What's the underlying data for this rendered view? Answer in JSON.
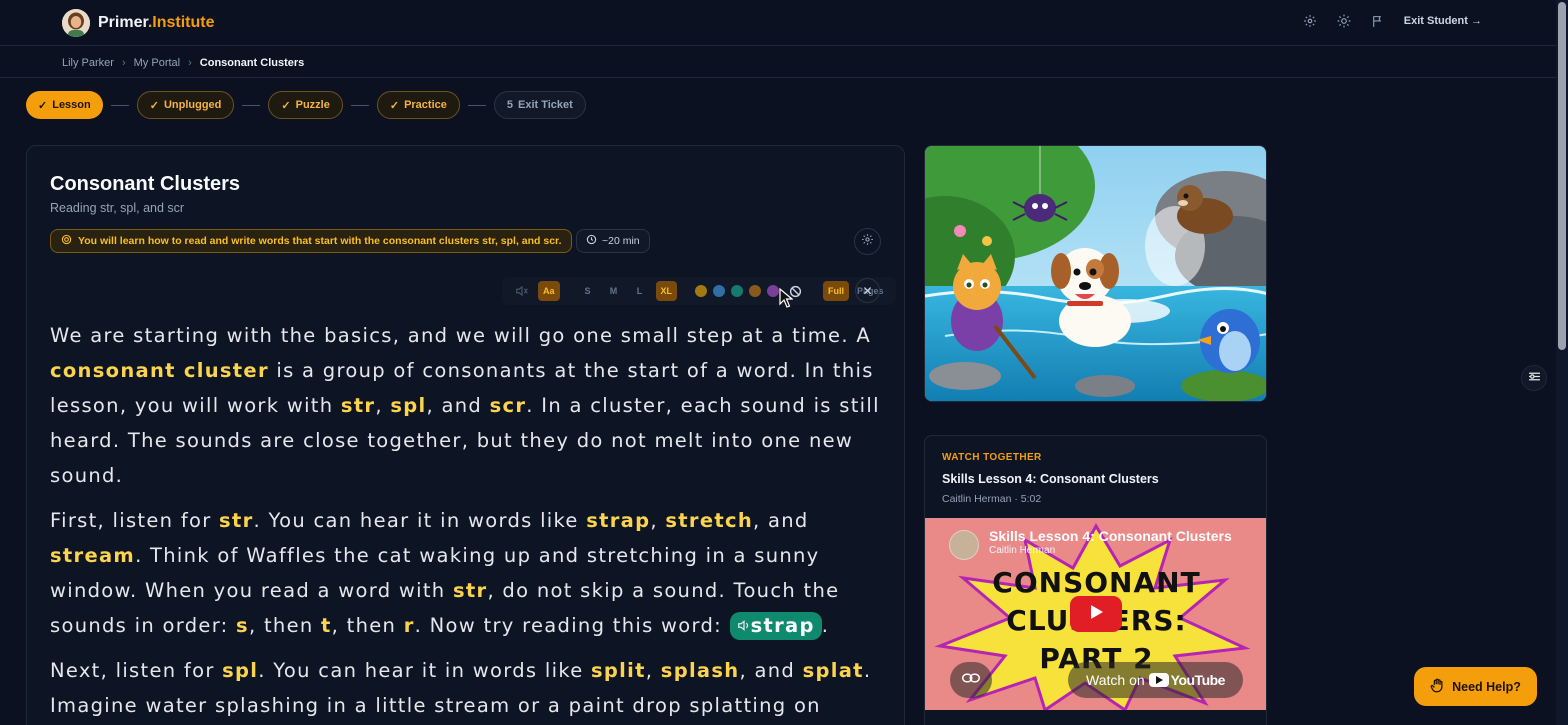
{
  "header": {
    "brand_primary": "Primer",
    "brand_accent": ".Institute",
    "exit_label": "Exit Student →",
    "icons": [
      "gear-icon",
      "sun-icon",
      "flag-icon"
    ]
  },
  "breadcrumb": {
    "items": [
      "Lily Parker",
      "My Portal",
      "Consonant Clusters"
    ]
  },
  "stepper": {
    "steps": [
      {
        "label": "Lesson",
        "state": "active",
        "marker": "✓"
      },
      {
        "label": "Unplugged",
        "state": "done",
        "marker": "✓"
      },
      {
        "label": "Puzzle",
        "state": "done",
        "marker": "✓"
      },
      {
        "label": "Practice",
        "state": "done",
        "marker": "✓"
      },
      {
        "label": "Exit Ticket",
        "state": "todo",
        "marker": "5"
      }
    ]
  },
  "lesson": {
    "title": "Consonant Clusters",
    "subtitle": "Reading str, spl, and scr",
    "objective": "You will learn how to read and write words that start with the consonant clusters str, spl, and scr.",
    "duration": "~20 min"
  },
  "reader_toolbar": {
    "font_toggle": "Aa",
    "sizes": [
      "S",
      "M",
      "L",
      "XL"
    ],
    "selected_size": "XL",
    "swatches": [
      "#a27a12",
      "#2f6fa6",
      "#167a6e",
      "#8a5a1c",
      "#7a3f98"
    ],
    "mode_full": "Full",
    "mode_pages": "Pages",
    "selected_mode": "Full"
  },
  "reading": {
    "p1": {
      "t1": "We are starting with the basics, and we will go one small step at a time. A ",
      "h1": "consonant cluster",
      "t2": " is a group of consonants at the start of a word. In this lesson, you will work with ",
      "h2": "str",
      "t3": ", ",
      "h3": "spl",
      "t4": ", and ",
      "h4": "scr",
      "t5": ". In a cluster, each sound is still heard. The sounds are close together, but they do not melt into one new sound."
    },
    "p2": {
      "t1": "First, listen for ",
      "h1": "str",
      "t2": ". You can hear it in words like ",
      "h2": "strap",
      "t3": ", ",
      "h3": "stretch",
      "t4": ", and ",
      "h4": "stream",
      "t5": ". Think of Waffles the cat waking up and stretching in a sunny window. When you read a word with ",
      "h5": "str",
      "t6": ", do not skip a sound. Touch the sounds in order: ",
      "h6": "s",
      "t7": ", then ",
      "h7": "t",
      "t8": ", then ",
      "h8": "r",
      "t9": ". Now try reading this word: ",
      "speak_word": "strap",
      "t10": "."
    },
    "p3": {
      "t1": "Next, listen for ",
      "h1": "spl",
      "t2": ". You can hear it in words like ",
      "h2": "split",
      "t3": ", ",
      "h3": "splash",
      "t4": ", and ",
      "h4": "splat",
      "t5": ". Imagine water splashing in a little stream or a paint drop splatting on"
    }
  },
  "video": {
    "eyebrow": "WATCH TOGETHER",
    "title": "Skills Lesson 4: Consonant Clusters",
    "meta": "Caitlin Herman · 5:02",
    "player_title": "Skills Lesson 4: Consonant Clusters",
    "player_channel": "Caitlin Herman",
    "art_line1": "CONSONANT",
    "art_line2": "CLUSTERS:",
    "art_line3": "PART 2",
    "watch_on": "Watch on",
    "youtube": "YouTube"
  },
  "help": {
    "label": "Need Help?"
  },
  "colors": {
    "accent": "#f59e0b",
    "background": "#0b1120",
    "highlight": "#fcd34d",
    "speak": "#0f8a6e"
  }
}
